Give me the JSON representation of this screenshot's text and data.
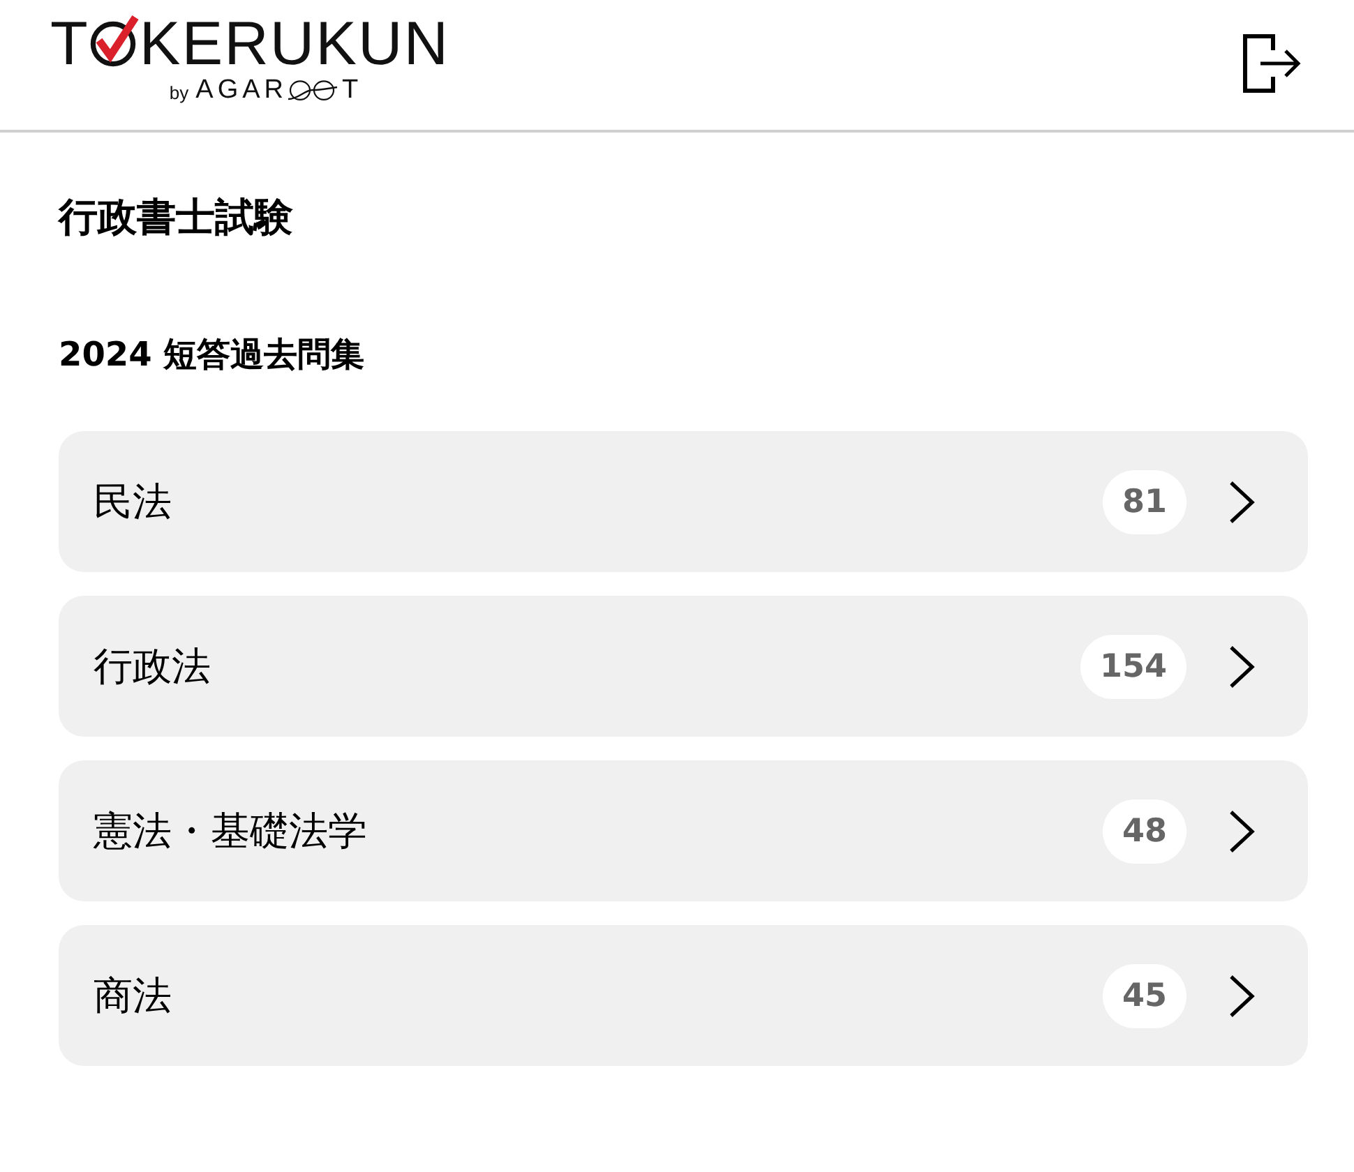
{
  "header": {
    "logo": {
      "lead": "T",
      "tail": "KERUKUN",
      "byline_prefix": "by",
      "byline_lead": "AGAR",
      "byline_tail": "T"
    }
  },
  "page": {
    "title": "行政書士試験",
    "section_title": "2024 短答過去問集"
  },
  "subjects": [
    {
      "label": "民法",
      "count": "81"
    },
    {
      "label": "行政法",
      "count": "154"
    },
    {
      "label": "憲法・基礎法学",
      "count": "48"
    },
    {
      "label": "商法",
      "count": "45"
    }
  ]
}
